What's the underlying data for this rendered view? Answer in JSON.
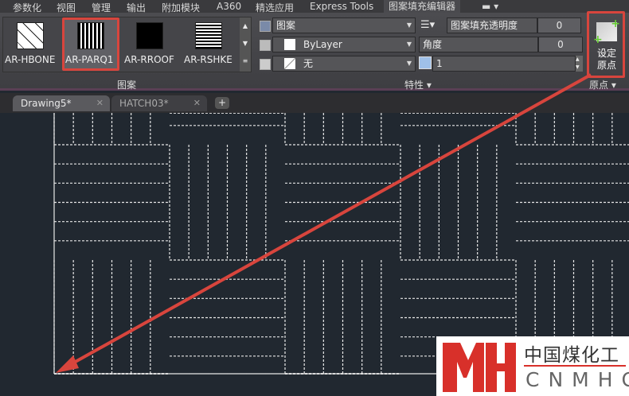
{
  "menu": [
    "参数化",
    "视图",
    "管理",
    "输出",
    "附加模块",
    "A360",
    "精选应用",
    "Express Tools",
    "图案填充编辑器"
  ],
  "patterns": {
    "items": [
      "AR-HBONE",
      "AR-PARQ1",
      "AR-RROOF",
      "AR-RSHKE"
    ],
    "selected": "AR-PARQ1",
    "panel_title": "图案"
  },
  "properties": {
    "type": "图案",
    "color": "ByLayer",
    "background": "无",
    "transparency_label": "图案填充透明度",
    "transparency": "0",
    "angle_label": "角度",
    "angle": "0",
    "scale": "1",
    "panel_title": "特性"
  },
  "origin": {
    "button": "设定原点",
    "button_line1": "设定",
    "button_line2": "原点",
    "panel_title": "原点"
  },
  "tabs": [
    {
      "label": "Drawing5*",
      "active": true
    },
    {
      "label": "HATCH03*",
      "active": false
    }
  ],
  "logo": {
    "cn": "中国煤化工",
    "en": "CNMHG",
    "mark": "MH"
  },
  "colors": {
    "accent": "#d8453d",
    "canvas": "#212830"
  }
}
